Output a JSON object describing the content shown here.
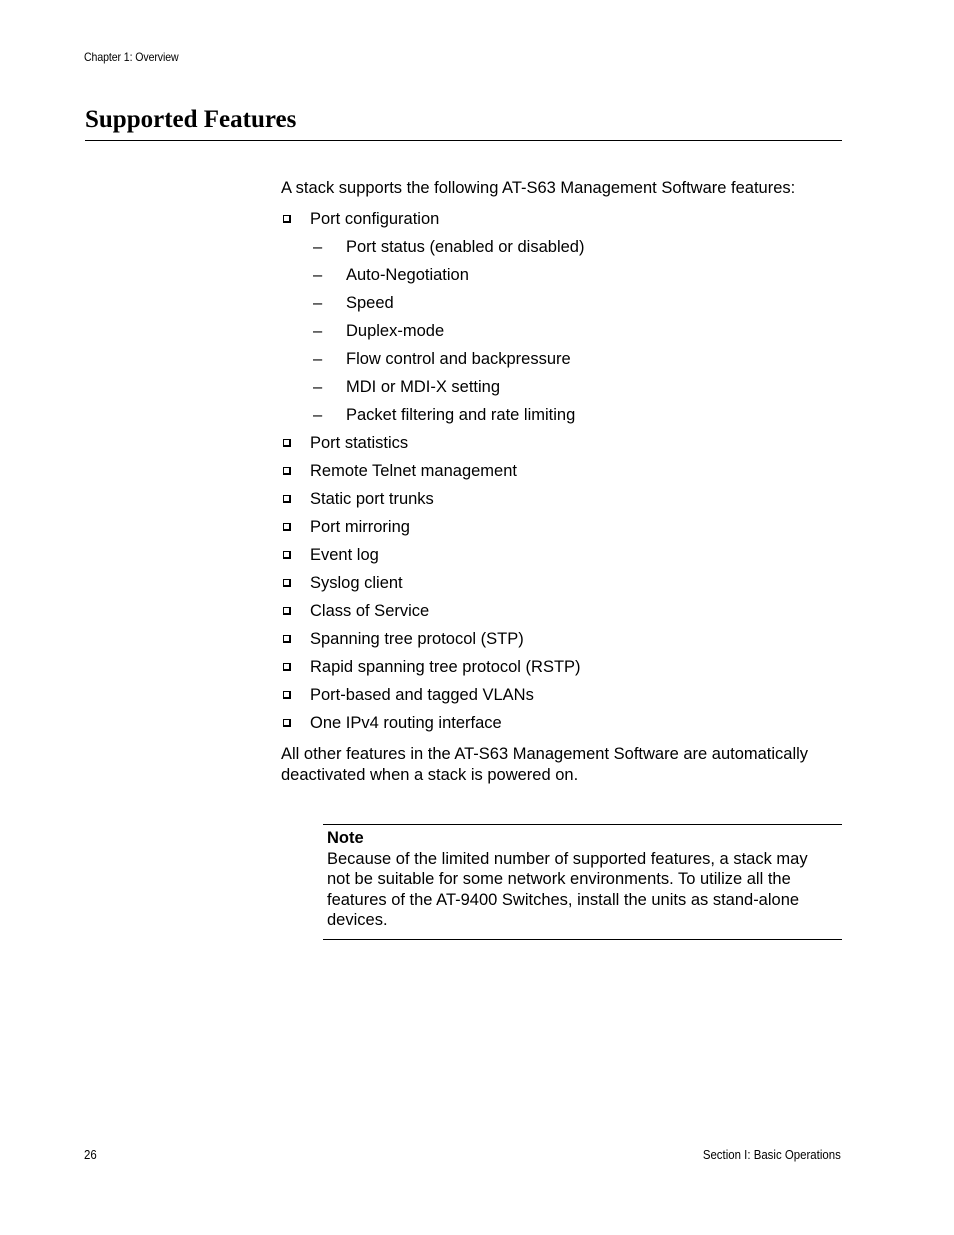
{
  "header": {
    "running_head": "Chapter 1: Overview"
  },
  "section": {
    "title": "Supported Features",
    "intro": "A stack supports the following AT-S63 Management Software features:",
    "features": [
      {
        "label": "Port configuration",
        "sub": [
          "Port status (enabled or disabled)",
          "Auto-Negotiation",
          "Speed",
          "Duplex-mode",
          "Flow control and backpressure",
          "MDI or MDI-X setting",
          "Packet filtering and rate limiting"
        ]
      },
      {
        "label": "Port statistics"
      },
      {
        "label": "Remote Telnet management"
      },
      {
        "label": "Static port trunks"
      },
      {
        "label": "Port mirroring"
      },
      {
        "label": "Event log"
      },
      {
        "label": "Syslog client"
      },
      {
        "label": "Class of Service"
      },
      {
        "label": "Spanning tree protocol (STP)"
      },
      {
        "label": "Rapid spanning tree protocol (RSTP)"
      },
      {
        "label": "Port-based and tagged VLANs"
      },
      {
        "label": "One IPv4 routing interface"
      }
    ],
    "sub_bullet_glyph": "–",
    "outro": "All other features in the AT-S63 Management Software are automatically deactivated when a stack is powered on."
  },
  "note": {
    "title": "Note",
    "body": "Because of the limited number of supported features, a stack may not be suitable for some network environments. To utilize all the features of the AT-9400 Switches, install the units as stand-alone devices."
  },
  "footer": {
    "page_number": "26",
    "section": "Section I: Basic Operations"
  }
}
